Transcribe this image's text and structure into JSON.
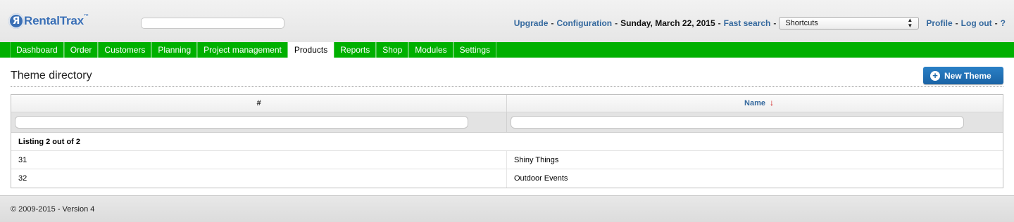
{
  "brand": {
    "logo_letter": "Я",
    "name": "RentalTrax",
    "tm": "™"
  },
  "topbar": {
    "upgrade": "Upgrade",
    "configuration": "Configuration",
    "date": "Sunday, March 22, 2015",
    "fast_search": "Fast search",
    "shortcuts_selected": "Shortcuts",
    "profile": "Profile",
    "logout": "Log out",
    "help": "?",
    "separator": "-"
  },
  "nav": {
    "tabs": [
      {
        "label": "Dashboard",
        "active": false
      },
      {
        "label": "Order",
        "active": false
      },
      {
        "label": "Customers",
        "active": false
      },
      {
        "label": "Planning",
        "active": false
      },
      {
        "label": "Project management",
        "active": false
      },
      {
        "label": "Products",
        "active": true
      },
      {
        "label": "Reports",
        "active": false
      },
      {
        "label": "Shop",
        "active": false
      },
      {
        "label": "Modules",
        "active": false
      },
      {
        "label": "Settings",
        "active": false
      }
    ]
  },
  "page": {
    "title": "Theme directory",
    "new_button": "New Theme"
  },
  "table": {
    "columns": [
      "#",
      "Name"
    ],
    "sort_indicator": "↓",
    "listing_text": "Listing 2 out of 2",
    "rows": [
      {
        "id": "31",
        "name": "Shiny Things"
      },
      {
        "id": "32",
        "name": "Outdoor Events"
      }
    ]
  },
  "footer": {
    "text": "© 2009-2015 - Version 4"
  },
  "colors": {
    "nav_green": "#00b000",
    "link_blue": "#35699e",
    "button_blue": "#1d6aaa",
    "sort_red": "#cc0000"
  }
}
